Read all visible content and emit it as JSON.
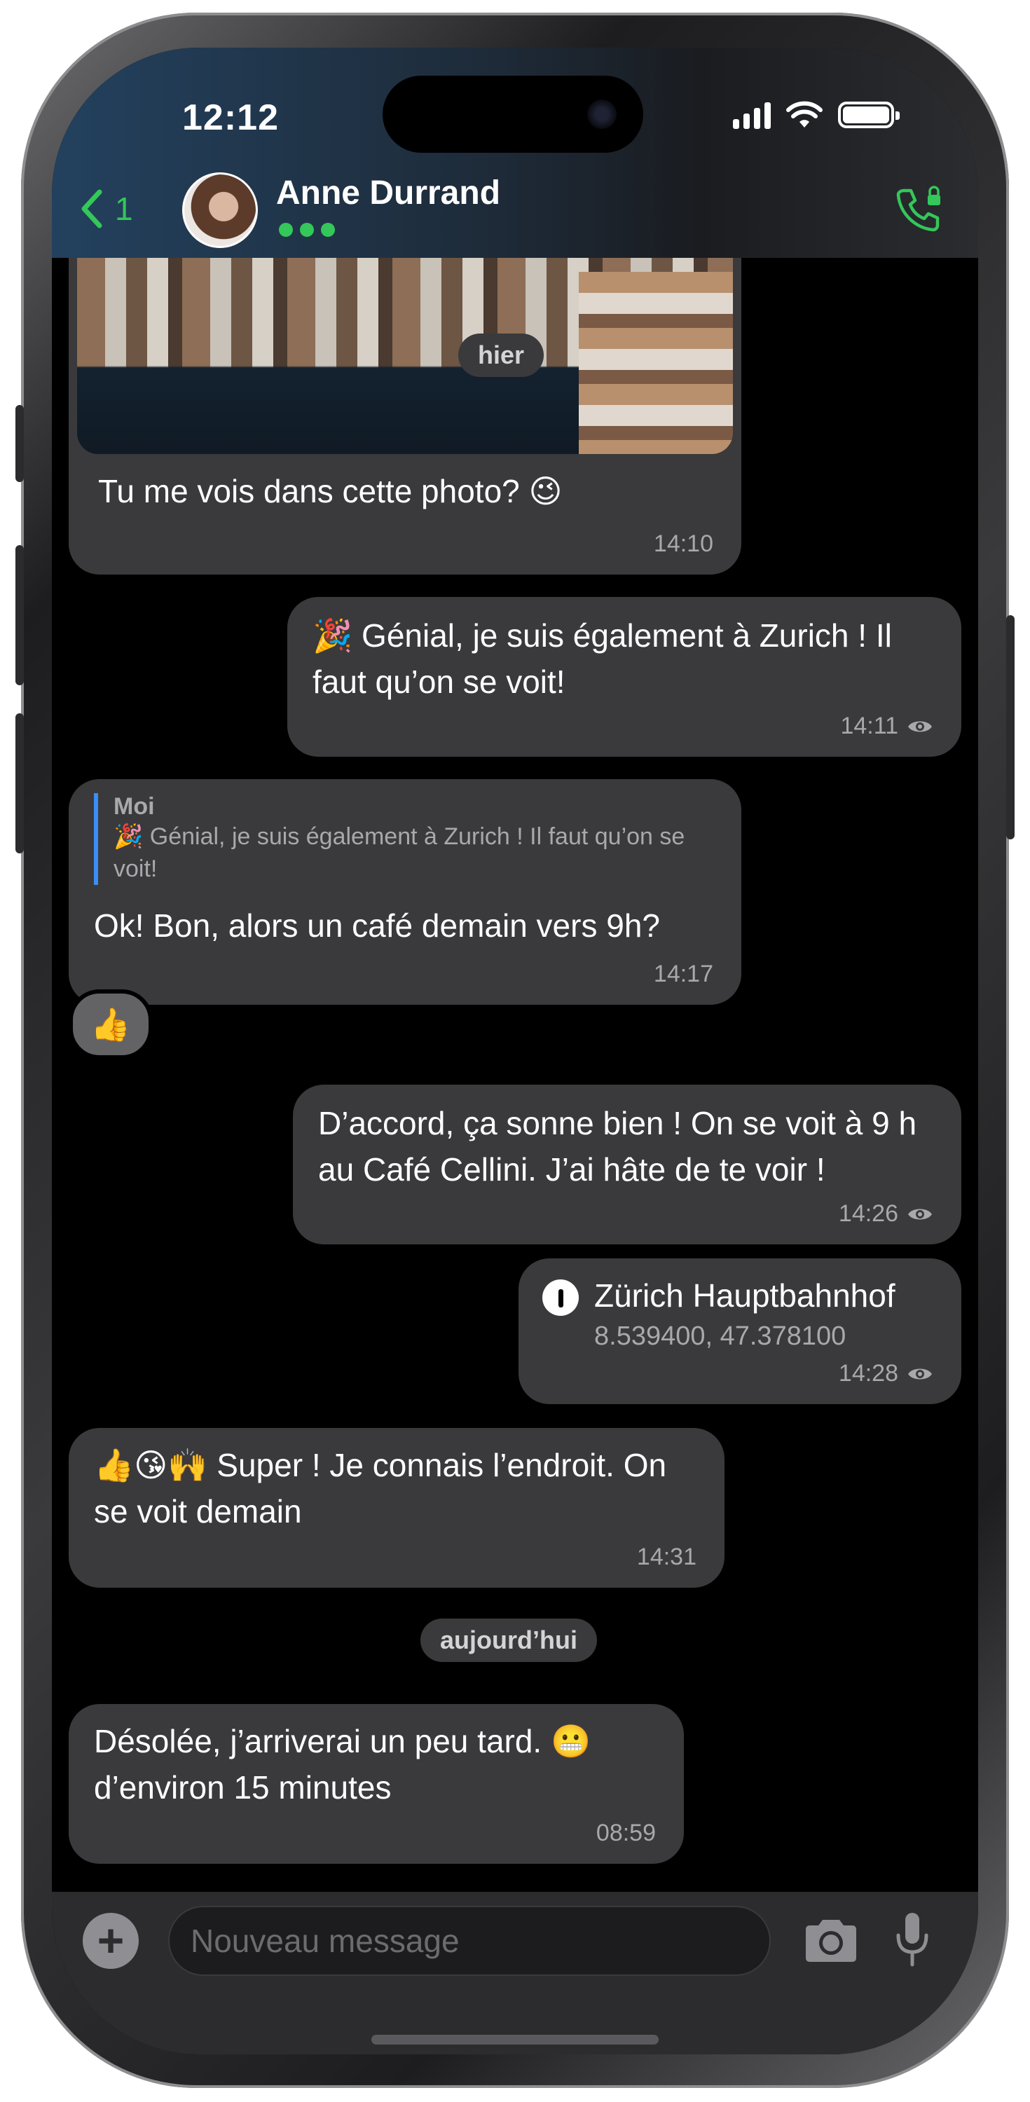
{
  "status_bar": {
    "time": "12:12"
  },
  "header": {
    "back_count": "1",
    "contact_name": "Anne Durrand"
  },
  "messages": {
    "day_hier": "hier",
    "m1": {
      "text": "Tu me vois dans cette photo? 😉",
      "time": "14:10"
    },
    "m2": {
      "text": "🎉 Génial, je suis également à Zurich ! Il faut qu’on se voit!",
      "time": "14:11"
    },
    "m3": {
      "reply_author": "Moi",
      "reply_text": "🎉 Génial, je suis également à Zurich ! Il faut qu’on se voit!",
      "text": "Ok! Bon, alors un café demain vers 9h?",
      "time": "14:17",
      "reaction": "👍"
    },
    "m4": {
      "text": "D’accord, ça sonne bien ! On se voit à 9 h au Café Cellini. J’ai hâte de te voir !",
      "time": "14:26"
    },
    "m5": {
      "place": "Zürich Hauptbahnhof",
      "coords": "8.539400, 47.378100",
      "time": "14:28"
    },
    "m6": {
      "text": "👍😘🙌 Super ! Je connais l’endroit. On se voit demain",
      "time": "14:31"
    },
    "day_today": "aujourd’hui",
    "m7": {
      "text": "Désolée, j’arriverai un peu tard. 😬 d’environ 15 minutes",
      "time": "08:59"
    }
  },
  "composer": {
    "placeholder": "Nouveau message"
  },
  "colors": {
    "accent": "#34c759",
    "bubble": "#3a3a3c",
    "background": "#000000",
    "reply_bar": "#3a8ef6"
  },
  "icons": [
    "chevron-left-icon",
    "phone-lock-icon",
    "eye-icon",
    "location-pin-icon",
    "plus-icon",
    "camera-icon",
    "microphone-icon",
    "wifi-icon",
    "signal-icon",
    "battery-icon"
  ]
}
